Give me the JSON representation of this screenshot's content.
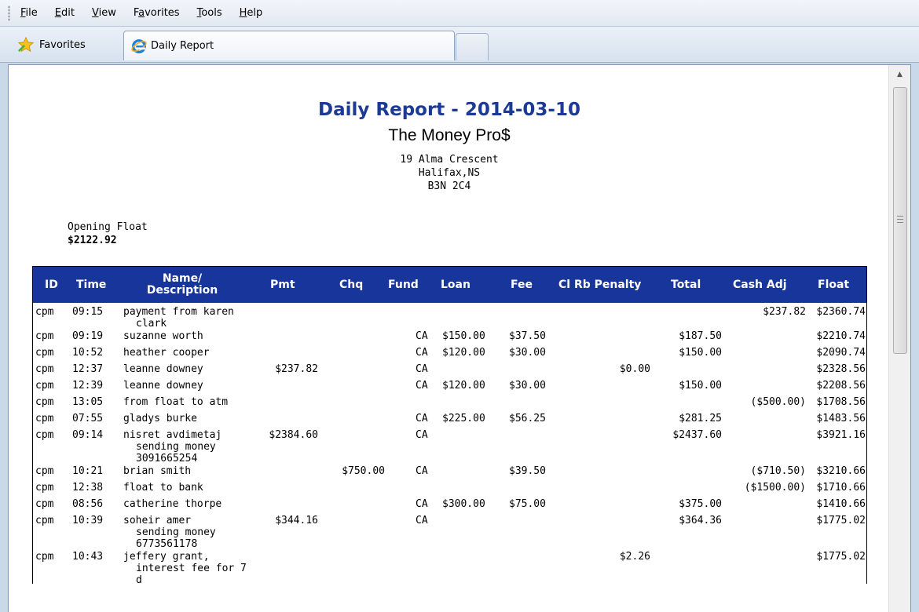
{
  "menu": [
    "File",
    "Edit",
    "View",
    "Favorites",
    "Tools",
    "Help"
  ],
  "menu_underline": [
    "F",
    "E",
    "V",
    "a",
    "T",
    "H"
  ],
  "favorites_label": "Favorites",
  "tab_title": "Daily Report",
  "report": {
    "title": "Daily Report - 2014-03-10",
    "company": "The Money Pro$",
    "address": [
      "19 Alma Crescent",
      "Halifax,NS",
      "B3N 2C4"
    ],
    "opening_float_label": "Opening Float",
    "opening_float_value": "$2122.92"
  },
  "table": {
    "headers": [
      "ID",
      "Time",
      "Name/",
      "Description",
      "Pmt",
      "Chq",
      "Fund",
      "Loan",
      "Fee",
      "Cl Rb Penalty",
      "Total",
      "Cash Adj",
      "Float"
    ],
    "rows": [
      {
        "id": "cpm",
        "time": "09:15",
        "desc": [
          "payment from karen",
          "clark"
        ],
        "pmt": "",
        "chq": "",
        "fund": "",
        "loan": "",
        "fee": "",
        "penalty": "",
        "total": "",
        "cashadj": "$237.82",
        "float": "$2360.74"
      },
      {
        "id": "cpm",
        "time": "09:19",
        "desc": [
          "suzanne worth"
        ],
        "pmt": "",
        "chq": "",
        "fund": "CA",
        "loan": "$150.00",
        "fee": "$37.50",
        "penalty": "",
        "total": "$187.50",
        "cashadj": "",
        "float": "$2210.74"
      },
      {
        "id": "cpm",
        "time": "10:52",
        "desc": [
          "heather cooper"
        ],
        "pmt": "",
        "chq": "",
        "fund": "CA",
        "loan": "$120.00",
        "fee": "$30.00",
        "penalty": "",
        "total": "$150.00",
        "cashadj": "",
        "float": "$2090.74"
      },
      {
        "id": "cpm",
        "time": "12:37",
        "desc": [
          "leanne downey"
        ],
        "pmt": "$237.82",
        "chq": "",
        "fund": "CA",
        "loan": "",
        "fee": "",
        "penalty": "$0.00",
        "total": "",
        "cashadj": "",
        "float": "$2328.56"
      },
      {
        "id": "cpm",
        "time": "12:39",
        "desc": [
          "leanne downey"
        ],
        "pmt": "",
        "chq": "",
        "fund": "CA",
        "loan": "$120.00",
        "fee": "$30.00",
        "penalty": "",
        "total": "$150.00",
        "cashadj": "",
        "float": "$2208.56"
      },
      {
        "id": "cpm",
        "time": "13:05",
        "desc": [
          "from float to atm"
        ],
        "pmt": "",
        "chq": "",
        "fund": "",
        "loan": "",
        "fee": "",
        "penalty": "",
        "total": "",
        "cashadj": "($500.00)",
        "float": "$1708.56"
      },
      {
        "id": "cpm",
        "time": "07:55",
        "desc": [
          "gladys burke"
        ],
        "pmt": "",
        "chq": "",
        "fund": "CA",
        "loan": "$225.00",
        "fee": "$56.25",
        "penalty": "",
        "total": "$281.25",
        "cashadj": "",
        "float": "$1483.56"
      },
      {
        "id": "cpm",
        "time": "09:14",
        "desc": [
          "nisret avdimetaj",
          "sending money",
          "3091665254"
        ],
        "pmt": "$2384.60",
        "chq": "",
        "fund": "CA",
        "loan": "",
        "fee": "",
        "penalty": "",
        "total": "$2437.60",
        "cashadj": "",
        "float": "$3921.16"
      },
      {
        "id": "cpm",
        "time": "10:21",
        "desc": [
          "brian smith"
        ],
        "pmt": "",
        "chq": "$750.00",
        "fund": "CA",
        "loan": "",
        "fee": "$39.50",
        "penalty": "",
        "total": "",
        "cashadj": "($710.50)",
        "float": "$3210.66"
      },
      {
        "id": "cpm",
        "time": "12:38",
        "desc": [
          "float to bank"
        ],
        "pmt": "",
        "chq": "",
        "fund": "",
        "loan": "",
        "fee": "",
        "penalty": "",
        "total": "",
        "cashadj": "($1500.00)",
        "float": "$1710.66"
      },
      {
        "id": "cpm",
        "time": "08:56",
        "desc": [
          "catherine thorpe"
        ],
        "pmt": "",
        "chq": "",
        "fund": "CA",
        "loan": "$300.00",
        "fee": "$75.00",
        "penalty": "",
        "total": "$375.00",
        "cashadj": "",
        "float": "$1410.66"
      },
      {
        "id": "cpm",
        "time": "10:39",
        "desc": [
          "soheir amer",
          "sending money",
          "6773561178"
        ],
        "pmt": "$344.16",
        "chq": "",
        "fund": "CA",
        "loan": "",
        "fee": "",
        "penalty": "",
        "total": "$364.36",
        "cashadj": "",
        "float": "$1775.02"
      },
      {
        "id": "cpm",
        "time": "10:43",
        "desc": [
          "jeffery grant,",
          "interest fee for 7",
          "d"
        ],
        "pmt": "",
        "chq": "",
        "fund": "",
        "loan": "",
        "fee": "",
        "penalty": "$2.26",
        "total": "",
        "cashadj": "",
        "float": "$1775.02"
      }
    ]
  }
}
